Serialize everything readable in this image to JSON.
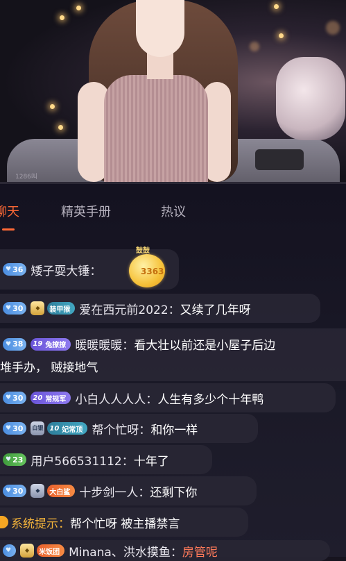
{
  "stream": {
    "watermark": "1286叫"
  },
  "tabs": [
    {
      "label": "聊天",
      "active": true
    },
    {
      "label": "精英手册",
      "active": false
    },
    {
      "label": "热议",
      "active": false
    }
  ],
  "chat": [
    {
      "level": "36",
      "name": "矮子耍大锤：",
      "sticker_caption": "鼓鼓",
      "sticker_number": "3363"
    },
    {
      "level": "30",
      "fan_badge": "装甲猴",
      "name": "爱在西元前2022：",
      "text": "又续了几年呀"
    },
    {
      "level": "38",
      "fan_level": "19",
      "fan_badge": "兔撩撩",
      "name": "暖暖暖暖：",
      "text": "看大壮以前还是小屋子后边",
      "text_cont": "堆手办，  贼接地气"
    },
    {
      "level": "30",
      "fan_level": "20",
      "fan_badge": "常规军",
      "name": "小白人人人人：",
      "text": "人生有多少个十年鸭"
    },
    {
      "level": "30",
      "guard": "白银",
      "fan_level": "10",
      "fan_badge": "妃常顶",
      "name": "帮个忙呀：",
      "text": "和你一样"
    },
    {
      "level": "23",
      "name": "用户566531112：",
      "text": "十年了"
    },
    {
      "level": "30",
      "fan_badge": "大白鲨",
      "name": "十步剑一人：",
      "text": "还剩下你"
    },
    {
      "system_label": "系统提示：",
      "text": "帮个忙呀 被主播禁言"
    },
    {
      "level": "",
      "fan_badge": "米饭团",
      "name": "Minana、洪水摸鱼：",
      "text": "房管呢"
    }
  ],
  "colors": {
    "accent": "#ff6a36",
    "system": "#f5b43a"
  }
}
